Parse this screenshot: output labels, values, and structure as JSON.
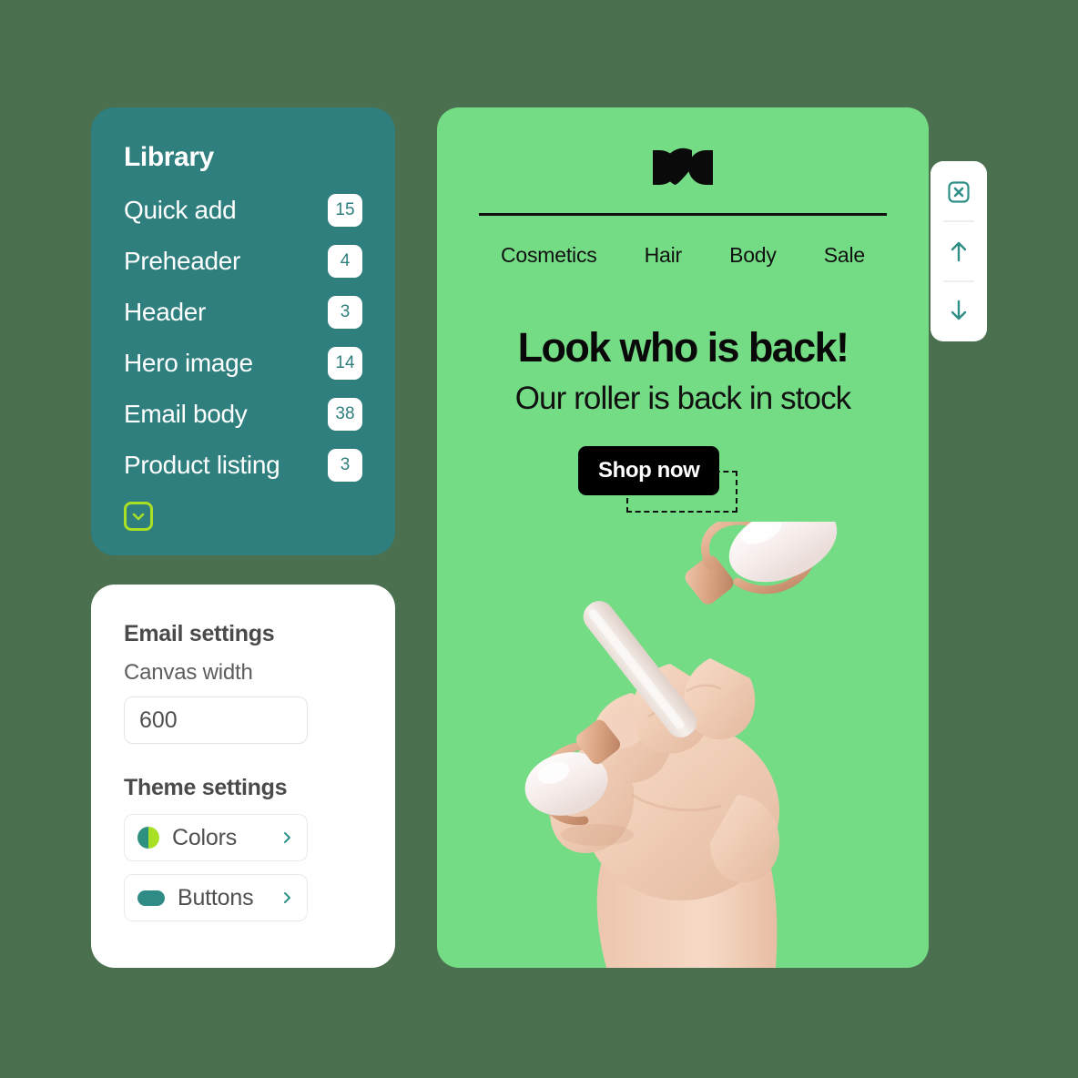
{
  "theme": {
    "page_bg": "#4a7050",
    "teal": "#2e7f7e",
    "lime": "#a9e023",
    "email_green": "#74dc84",
    "ink": "#111111"
  },
  "library": {
    "title": "Library",
    "items": [
      {
        "label": "Quick add",
        "count": "15"
      },
      {
        "label": "Preheader",
        "count": "4"
      },
      {
        "label": "Header",
        "count": "3"
      },
      {
        "label": "Hero image",
        "count": "14"
      },
      {
        "label": "Email body",
        "count": "38"
      },
      {
        "label": "Product listing",
        "count": "3"
      }
    ],
    "expand_icon": "chevron-down-icon"
  },
  "settings": {
    "email_settings_title": "Email settings",
    "canvas_width_label": "Canvas width",
    "canvas_width_value": "600",
    "canvas_width_placeholder": "600",
    "theme_settings_title": "Theme settings",
    "rows": [
      {
        "label": "Colors",
        "icon": "color-swatch-icon",
        "chevron": "chevron-right-icon"
      },
      {
        "label": "Buttons",
        "icon": "button-pill-icon",
        "chevron": "chevron-right-icon"
      }
    ]
  },
  "email": {
    "logo_alt": "brand-logo",
    "nav": [
      "Cosmetics",
      "Hair",
      "Body",
      "Sale"
    ],
    "headline": "Look who is back!",
    "subheadline": "Our roller is back in stock",
    "cta_label": "Shop now",
    "hero_image_alt": "hand-holding-rose-quartz-face-roller"
  },
  "toolbar": {
    "delete_icon": "delete-x-icon",
    "move_up_icon": "arrow-up-icon",
    "move_down_icon": "arrow-down-icon"
  }
}
